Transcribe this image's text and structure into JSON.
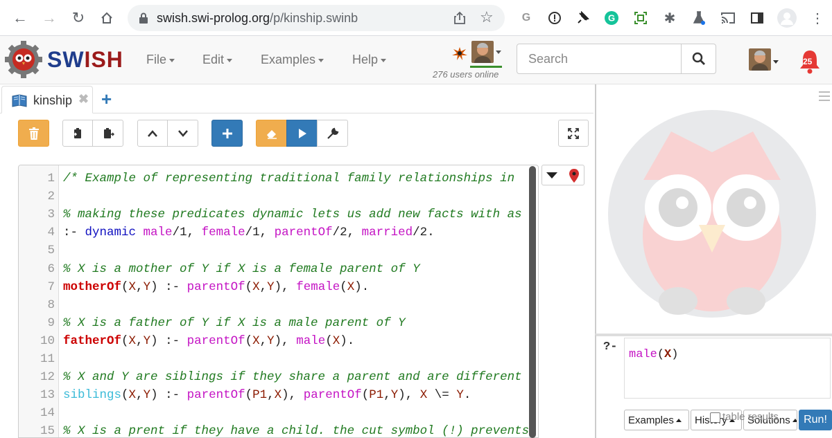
{
  "browser": {
    "url_host": "swish.swi-prolog.org",
    "url_path": "/p/kinship.swinb"
  },
  "app": {
    "logo_part1": "SW",
    "logo_part2": "ISH",
    "menu": [
      {
        "label": "File"
      },
      {
        "label": "Edit"
      },
      {
        "label": "Examples"
      },
      {
        "label": "Help"
      }
    ],
    "online_text": "276 users online",
    "search_placeholder": "Search",
    "notification_count": "25"
  },
  "tabs": [
    {
      "label": "kinship"
    }
  ],
  "editor": {
    "lines": [
      {
        "n": "1",
        "tokens": [
          {
            "t": "/* Example of representing traditional family relationships in",
            "c": "cm"
          }
        ]
      },
      {
        "n": "2",
        "tokens": []
      },
      {
        "n": "3",
        "tokens": [
          {
            "t": "% making these predicates dynamic lets us add new facts with as",
            "c": "cm"
          }
        ]
      },
      {
        "n": "4",
        "tokens": [
          {
            "t": ":- ",
            "c": "pn"
          },
          {
            "t": "dynamic",
            "c": "kw"
          },
          {
            "t": " ",
            "c": "pn"
          },
          {
            "t": "male",
            "c": "pr"
          },
          {
            "t": "/1, ",
            "c": "pn"
          },
          {
            "t": "female",
            "c": "pr"
          },
          {
            "t": "/1, ",
            "c": "pn"
          },
          {
            "t": "parentOf",
            "c": "pr"
          },
          {
            "t": "/2, ",
            "c": "pn"
          },
          {
            "t": "married",
            "c": "pr"
          },
          {
            "t": "/2.",
            "c": "pn"
          }
        ]
      },
      {
        "n": "5",
        "tokens": []
      },
      {
        "n": "6",
        "tokens": [
          {
            "t": "% X is a mother of Y if X is a female parent of Y",
            "c": "cm"
          }
        ]
      },
      {
        "n": "7",
        "tokens": [
          {
            "t": "motherOf",
            "c": "hd"
          },
          {
            "t": "(",
            "c": "pn"
          },
          {
            "t": "X",
            "c": "vr"
          },
          {
            "t": ",",
            "c": "pn"
          },
          {
            "t": "Y",
            "c": "vr"
          },
          {
            "t": ") :- ",
            "c": "pn"
          },
          {
            "t": "parentOf",
            "c": "pr"
          },
          {
            "t": "(",
            "c": "pn"
          },
          {
            "t": "X",
            "c": "vr"
          },
          {
            "t": ",",
            "c": "pn"
          },
          {
            "t": "Y",
            "c": "vr"
          },
          {
            "t": "), ",
            "c": "pn"
          },
          {
            "t": "female",
            "c": "pr"
          },
          {
            "t": "(",
            "c": "pn"
          },
          {
            "t": "X",
            "c": "vr"
          },
          {
            "t": ").",
            "c": "pn"
          }
        ]
      },
      {
        "n": "8",
        "tokens": []
      },
      {
        "n": "9",
        "tokens": [
          {
            "t": "% X is a father of Y if X is a male parent of Y",
            "c": "cm"
          }
        ]
      },
      {
        "n": "10",
        "tokens": [
          {
            "t": "fatherOf",
            "c": "hd"
          },
          {
            "t": "(",
            "c": "pn"
          },
          {
            "t": "X",
            "c": "vr"
          },
          {
            "t": ",",
            "c": "pn"
          },
          {
            "t": "Y",
            "c": "vr"
          },
          {
            "t": ") :- ",
            "c": "pn"
          },
          {
            "t": "parentOf",
            "c": "pr"
          },
          {
            "t": "(",
            "c": "pn"
          },
          {
            "t": "X",
            "c": "vr"
          },
          {
            "t": ",",
            "c": "pn"
          },
          {
            "t": "Y",
            "c": "vr"
          },
          {
            "t": "), ",
            "c": "pn"
          },
          {
            "t": "male",
            "c": "pr"
          },
          {
            "t": "(",
            "c": "pn"
          },
          {
            "t": "X",
            "c": "vr"
          },
          {
            "t": ").",
            "c": "pn"
          }
        ]
      },
      {
        "n": "11",
        "tokens": []
      },
      {
        "n": "12",
        "tokens": [
          {
            "t": "% X and Y are siblings if they share a parent and are different",
            "c": "cm"
          }
        ]
      },
      {
        "n": "13",
        "tokens": [
          {
            "t": "siblings",
            "c": "at"
          },
          {
            "t": "(",
            "c": "pn"
          },
          {
            "t": "X",
            "c": "vr"
          },
          {
            "t": ",",
            "c": "pn"
          },
          {
            "t": "Y",
            "c": "vr"
          },
          {
            "t": ") :- ",
            "c": "pn"
          },
          {
            "t": "parentOf",
            "c": "pr"
          },
          {
            "t": "(",
            "c": "pn"
          },
          {
            "t": "P1",
            "c": "vr"
          },
          {
            "t": ",",
            "c": "pn"
          },
          {
            "t": "X",
            "c": "vr"
          },
          {
            "t": "), ",
            "c": "pn"
          },
          {
            "t": "parentOf",
            "c": "pr"
          },
          {
            "t": "(",
            "c": "pn"
          },
          {
            "t": "P1",
            "c": "vr"
          },
          {
            "t": ",",
            "c": "pn"
          },
          {
            "t": "Y",
            "c": "vr"
          },
          {
            "t": "), ",
            "c": "pn"
          },
          {
            "t": "X",
            "c": "vr"
          },
          {
            "t": " \\= ",
            "c": "pn"
          },
          {
            "t": "Y",
            "c": "vr"
          },
          {
            "t": ".",
            "c": "pn"
          }
        ]
      },
      {
        "n": "14",
        "tokens": []
      },
      {
        "n": "15",
        "tokens": [
          {
            "t": "% X is a prent if they have a child. the cut symbol (!) prevents",
            "c": "cm"
          }
        ]
      }
    ]
  },
  "query": {
    "prompt": "?-",
    "pred": "male",
    "arg": "X",
    "examples_label": "Examples",
    "history_label": "History",
    "solutions_label": "Solutions",
    "table_results_label": "table results",
    "run_label": "Run!"
  },
  "colors": {
    "primary": "#337ab7",
    "warning": "#f0ad4e",
    "logo_blue": "#1f3d8c",
    "logo_red": "#9b1b1b"
  }
}
